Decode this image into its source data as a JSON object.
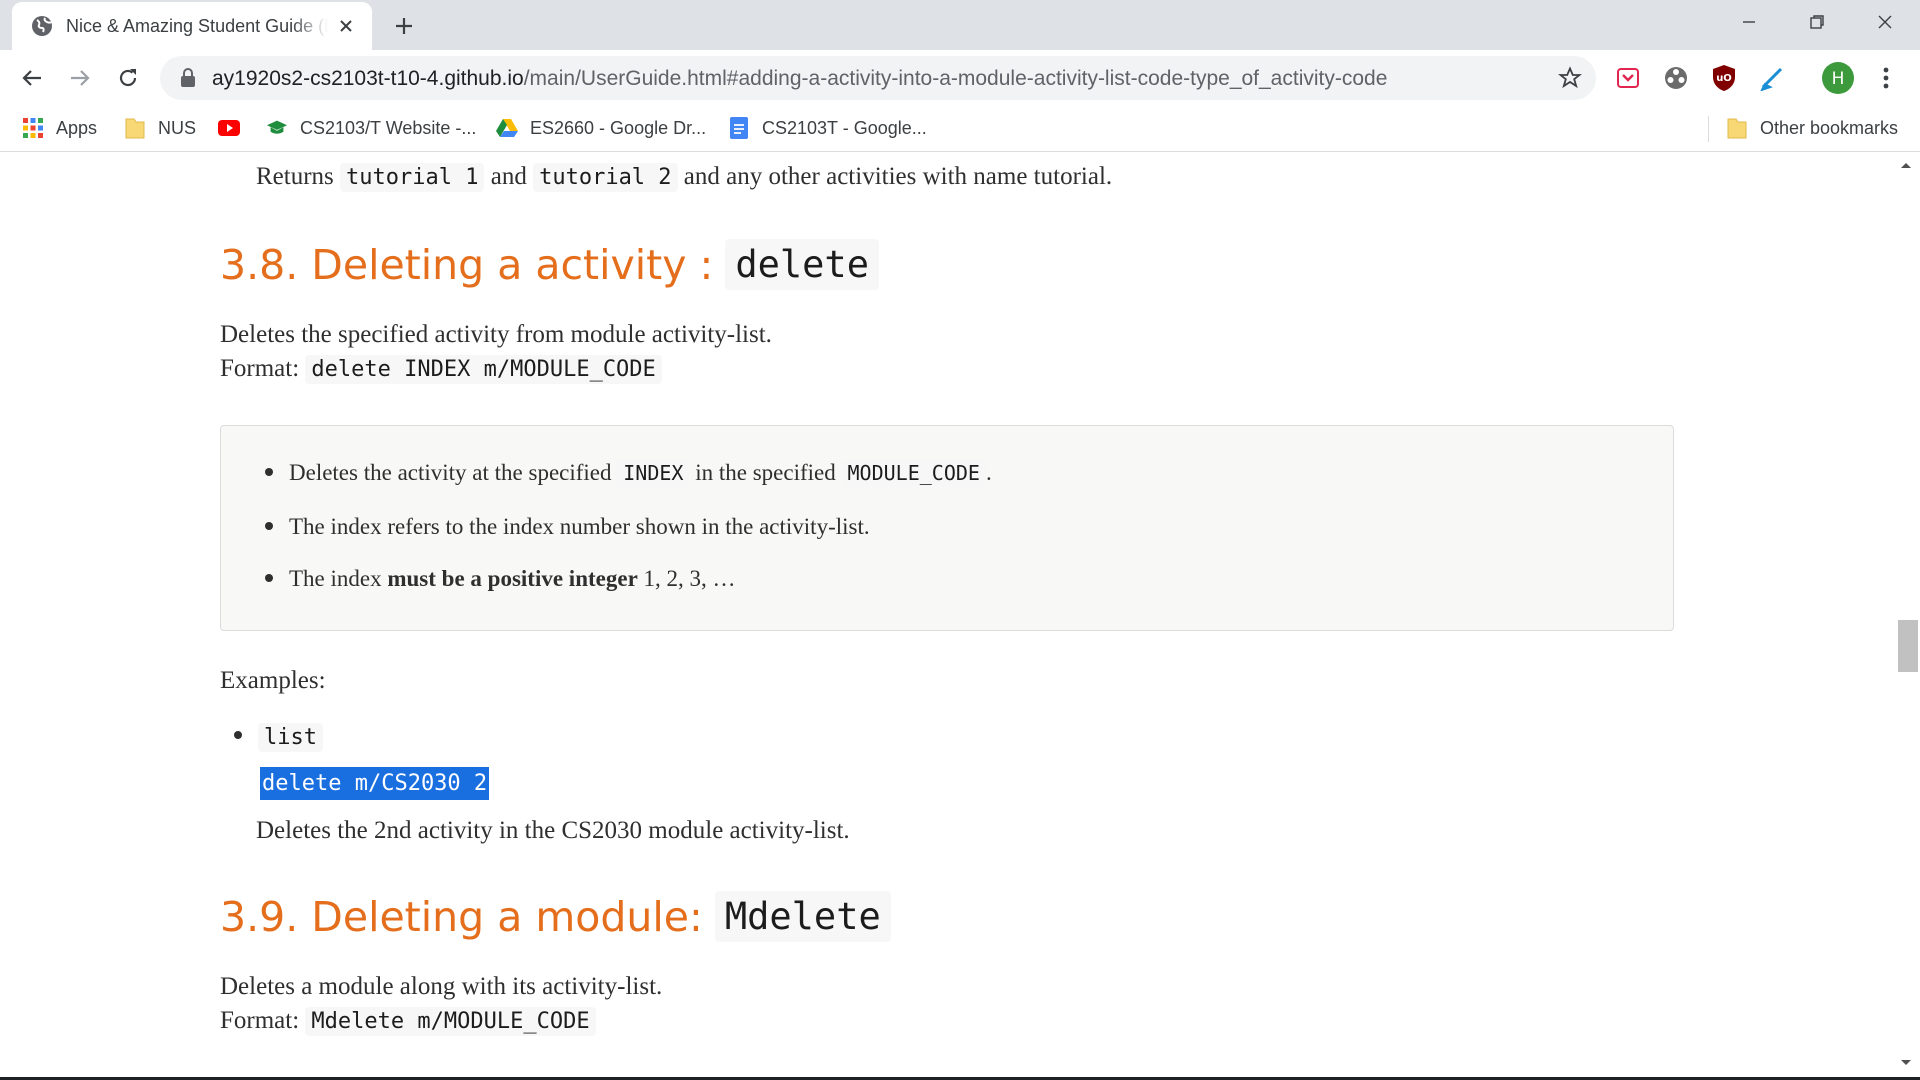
{
  "browser": {
    "tab_title": "Nice & Amazing Student Guide (NASG)",
    "url_host": "ay1920s2-cs2103t-t10-4.github.io",
    "url_path": "/main/UserGuide.html#adding-a-activity-into-a-module-activity-list-code-type_of_activity-code",
    "profile_initial": "H",
    "accent": "#1a73e8"
  },
  "bookmarks": [
    {
      "label": "Apps",
      "icon": "apps-grid-icon"
    },
    {
      "label": "NUS",
      "icon": "folder-icon"
    },
    {
      "label": "",
      "icon": "youtube-icon"
    },
    {
      "label": "CS2103/T Website -...",
      "icon": "graduation-cap-icon"
    },
    {
      "label": "ES2660 - Google Dr...",
      "icon": "google-drive-icon"
    },
    {
      "label": "CS2103T - Google...",
      "icon": "google-docs-icon"
    },
    {
      "label": "Other bookmarks",
      "icon": "folder-icon"
    }
  ],
  "page": {
    "returns_line": {
      "prefix": "Returns",
      "code1": "tutorial 1",
      "and": "and",
      "code2": "tutorial 2",
      "suffix": "and any other activities with name tutorial."
    },
    "section_38": {
      "heading": "3.8. Deleting a activity :",
      "heading_code": "delete",
      "description": "Deletes the specified activity from module activity-list.",
      "format_label": "Format:",
      "format_code": "delete INDEX m/MODULE_CODE",
      "notes": [
        {
          "pre": "Deletes the activity at the specified",
          "code1": "INDEX",
          "mid": "in the specified",
          "code2": "MODULE_CODE",
          "post": "."
        },
        {
          "text": "The index refers to the index number shown in the activity-list."
        },
        {
          "pre": "The index",
          "bold": "must be a positive integer",
          "post": "1, 2, 3, …"
        }
      ],
      "examples_label": "Examples:",
      "example_cmd1": "list",
      "example_cmd2": "delete m/CS2030 2",
      "example_desc": "Deletes the 2nd activity in the CS2030 module activity-list."
    },
    "section_39": {
      "heading": "3.9. Deleting a module:",
      "heading_code": "Mdelete",
      "description": "Deletes a module along with its activity-list.",
      "format_label": "Format:",
      "format_code": "Mdelete m/MODULE_CODE"
    },
    "heading_color": "#e46e1c",
    "selection_color": "#1a6fe0"
  }
}
